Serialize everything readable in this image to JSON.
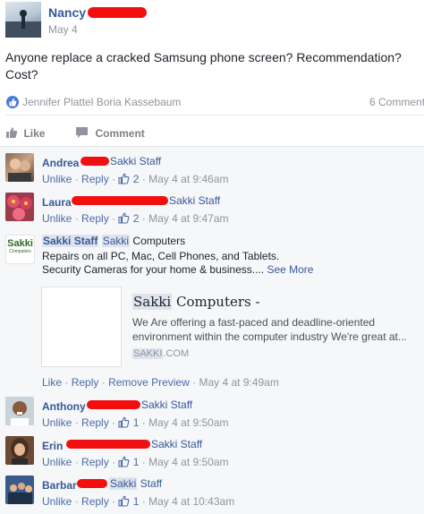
{
  "post": {
    "author": "Nancy",
    "date": "May 4",
    "text": "Anyone replace a cracked Samsung phone screen? Recommendation? Cost?",
    "likers": "Jennifer Plattel Boria Kassebaum",
    "comment_count": "6 Comments"
  },
  "actions": {
    "like": "Like",
    "comment": "Comment"
  },
  "labels": {
    "unlike": "Unlike",
    "like": "Like",
    "reply": "Reply",
    "remove_preview": "Remove Preview",
    "sep": "·"
  },
  "comments": [
    {
      "name": "Andrea",
      "tag": "Sakki Staff",
      "likes": "2",
      "time": "May 4 at 9:46am"
    },
    {
      "name": "Laura",
      "tag": "Sakki Staff",
      "likes": "2",
      "time": "May 4 at 9:47am"
    },
    {
      "name_part1": "Sakki",
      "name_part2": "Staff",
      "text_part1": "Sakki",
      "text_part2": " Computers",
      "line2": "Repairs on all PC, Mac, Cell Phones, and Tablets.",
      "line3": "Security Cameras for your home & business.... ",
      "see_more": "See More",
      "logo_line1": "Sakki",
      "logo_line2": "Computers",
      "preview": {
        "title_part1": "Sakki",
        "title_part2": " Computers -",
        "desc_line1": "We Are offering a fast-paced and deadline-oriented",
        "desc_line2": "environment within the computer industry We're great at...",
        "domain_part1": "SAKKI",
        "domain_part2": ".COM"
      },
      "time": "May 4 at 9:49am"
    },
    {
      "name": "Anthony",
      "tag": "Sakki Staff",
      "likes": "1",
      "time": "May 4 at 9:50am"
    },
    {
      "name": "Erin",
      "tag": "Sakki Staff",
      "likes": "1",
      "time": "May 4 at 9:50am"
    },
    {
      "name": "Barbar",
      "tag_part1": "Sakki",
      "tag_part2": " Staff",
      "likes": "1",
      "time": "May 4 at 10:43am"
    }
  ]
}
